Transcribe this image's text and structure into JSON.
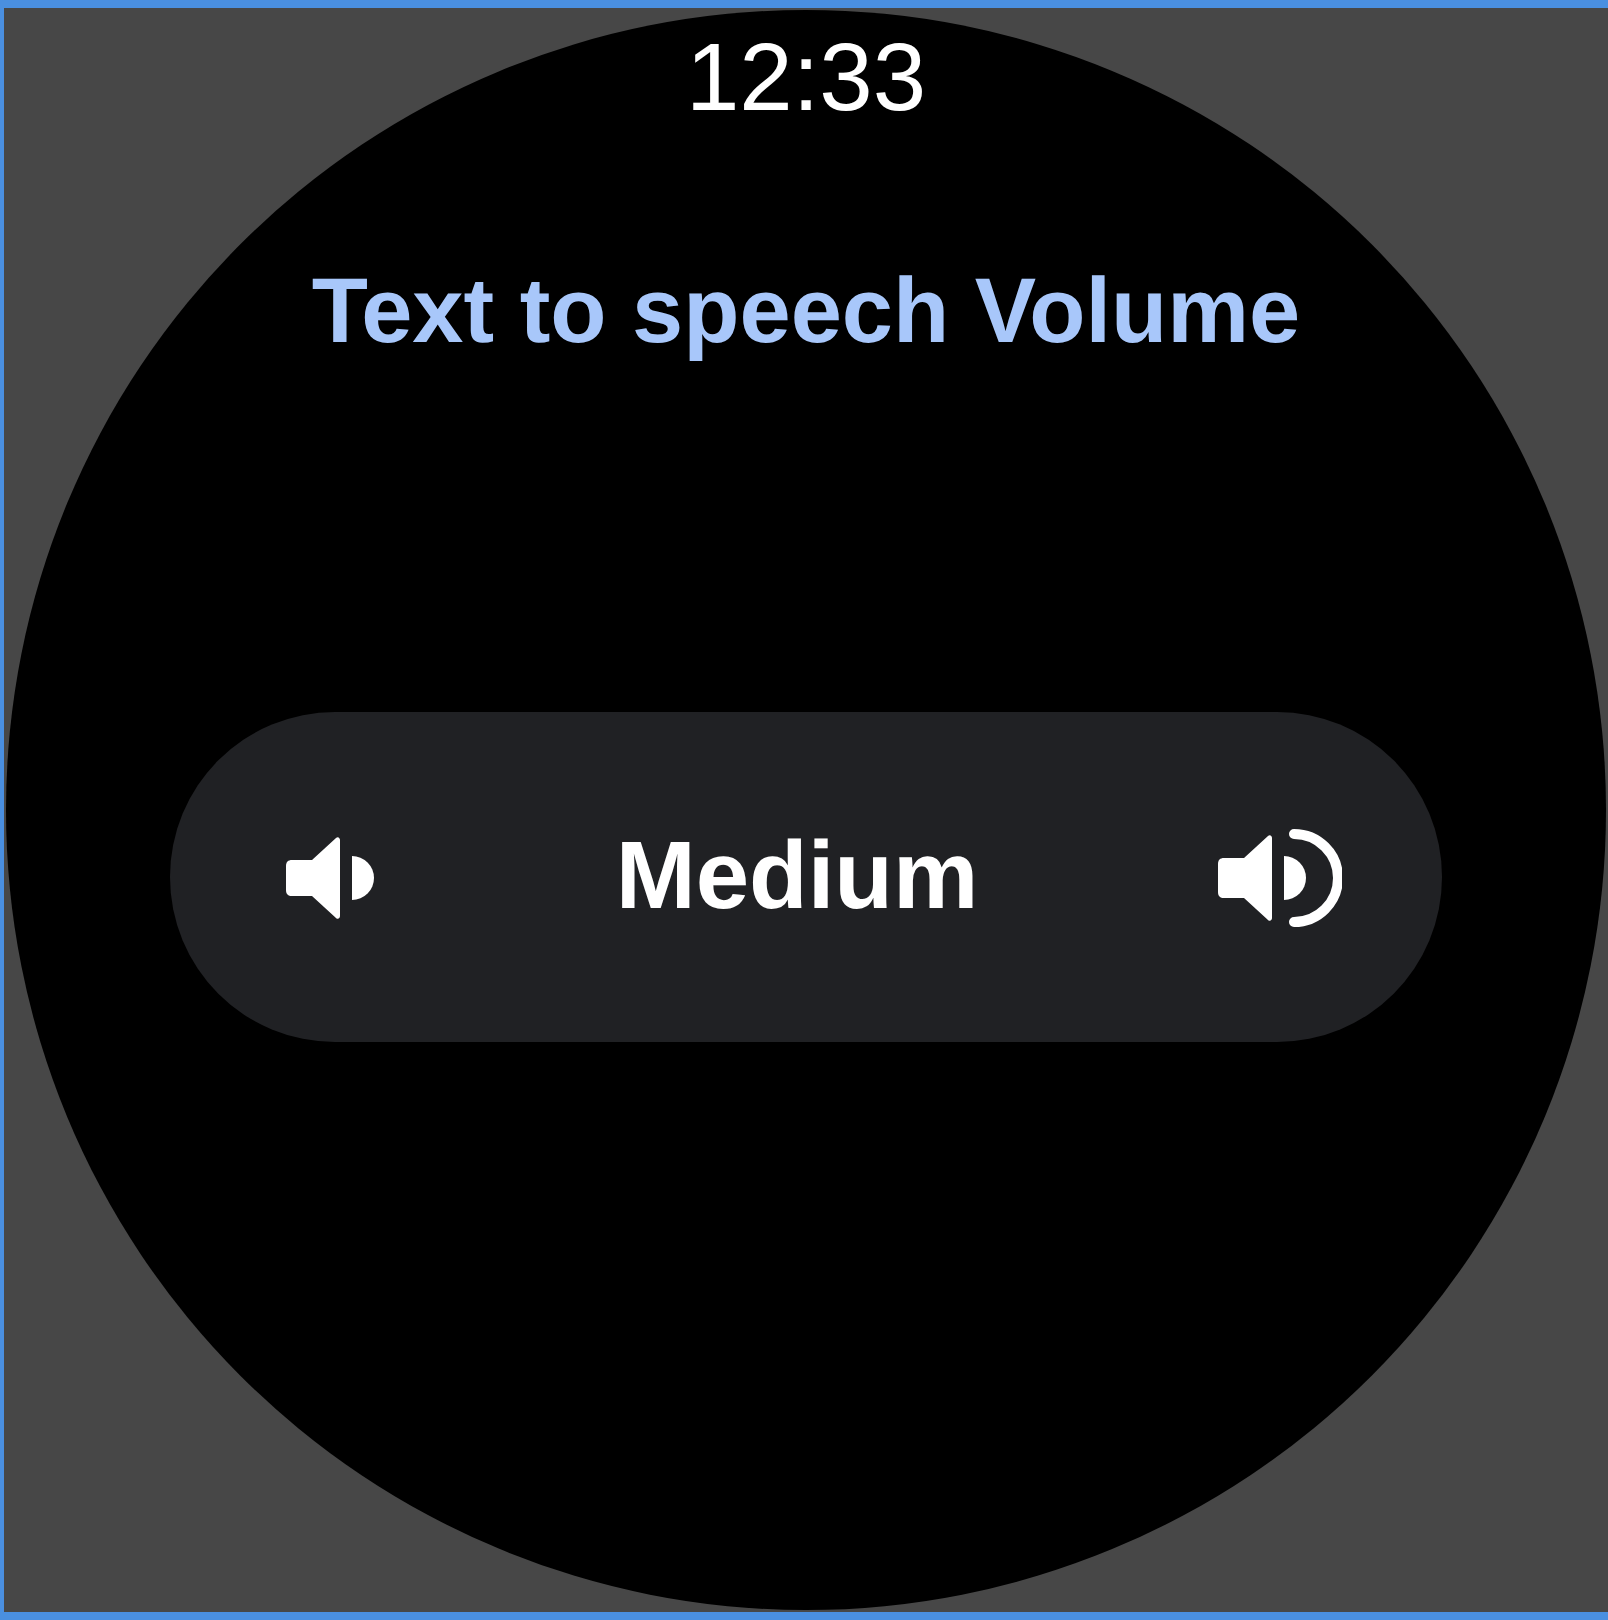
{
  "status_bar": {
    "time": "12:33"
  },
  "title": "Text to speech Volume",
  "volume_stepper": {
    "value": "Medium"
  }
}
